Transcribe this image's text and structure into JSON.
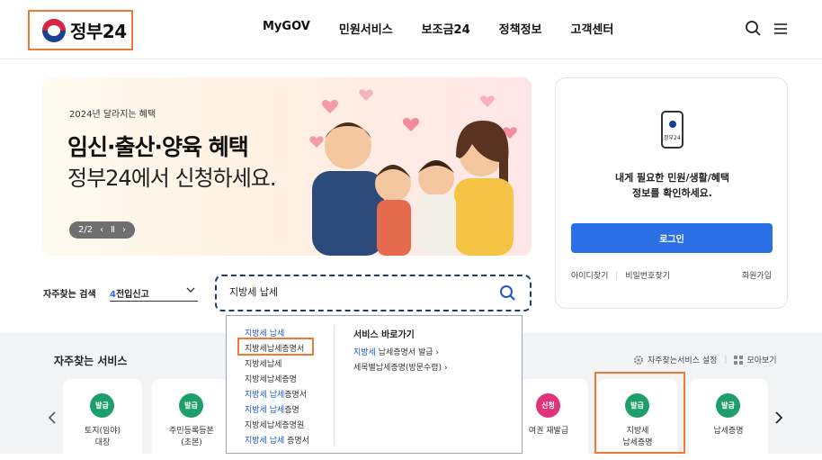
{
  "header": {
    "logo_text": "정부24",
    "nav": [
      "MyGOV",
      "민원서비스",
      "보조금24",
      "정책정보",
      "고객센터"
    ],
    "icons": [
      "search-icon",
      "menu-icon"
    ]
  },
  "banner": {
    "eyebrow": "2024년 달라지는 혜택",
    "headline": "임신·출산·양육 혜택",
    "subline": "정부24에서 신청하세요.",
    "pager_text": "2/2",
    "prev_label": "‹",
    "pause_label": "Ⅱ",
    "next_label": "›"
  },
  "login": {
    "phone_label": "정부24",
    "message_line1": "내게 필요한 민원/생활/혜택",
    "message_line2": "정보를 확인하세요.",
    "login_button": "로그인",
    "find_id": "아이디찾기",
    "find_pw": "비밀번호찾기",
    "join": "회원가입"
  },
  "search": {
    "freq_label": "자주찾는 검색",
    "freq_num": "4",
    "freq_text": "전입신고",
    "query": "지방세 납세"
  },
  "autocomplete": {
    "suggestions": [
      {
        "hl": "지방세 납세",
        "rest": ""
      },
      {
        "hl": "",
        "rest": "지방세납세증명서"
      },
      {
        "hl": "",
        "rest": "지방세납세"
      },
      {
        "hl": "",
        "rest": "지방세납세증명"
      },
      {
        "hl": "지방세 납세",
        "rest": "증명서"
      },
      {
        "hl": "지방세 납세",
        "rest": "증명"
      },
      {
        "hl": "",
        "rest": "지방세납세증명원"
      },
      {
        "hl": "지방세 납세",
        "rest": " 증명서"
      }
    ],
    "shortcut_title": "서비스 바로가기",
    "shortcuts": [
      {
        "hl": "지방세",
        "rest": " 납세증명서 발급 ›"
      },
      {
        "hl": "",
        "rest": "세목별납세증명(방문수령) ›"
      }
    ]
  },
  "services": {
    "title": "자주찾는 서비스",
    "settings": "자주찾는서비스 설정",
    "view_all": "모아보기",
    "tiles": [
      {
        "badge": "발급",
        "color": "#1e9e6a",
        "line1": "토지(임야)",
        "line2": "대장"
      },
      {
        "badge": "발급",
        "color": "#1e9e6a",
        "line1": "주민등록등본",
        "line2": "(초본)"
      },
      {
        "badge": "신청",
        "color": "#e0337a",
        "line1": "여권 재발급",
        "line2": ""
      },
      {
        "badge": "발급",
        "color": "#1e9e6a",
        "line1": "지방세",
        "line2": "납세증명"
      },
      {
        "badge": "발급",
        "color": "#1e9e6a",
        "line1": "납세증명",
        "line2": ""
      }
    ]
  }
}
